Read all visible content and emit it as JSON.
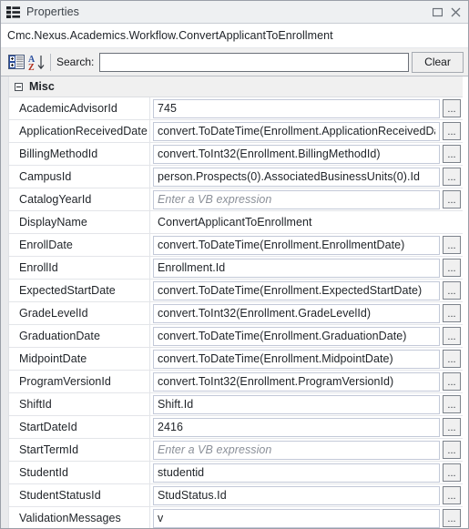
{
  "window": {
    "title": "Properties",
    "icon": "properties-grid-icon",
    "controls": [
      {
        "name": "maximize-button",
        "glyph": "maximize-icon"
      },
      {
        "name": "close-button",
        "glyph": "close-icon"
      }
    ]
  },
  "type_header": {
    "text": "Cmc.Nexus.Academics.Workflow.ConvertApplicantToEnrollment"
  },
  "toolbar": {
    "categorized_button": "categorized-view-icon",
    "alphabetical_button": "sort-alphabetical-icon",
    "search_label": "Search:",
    "search_value": "",
    "search_placeholder": "",
    "clear_label": "Clear"
  },
  "colors": {
    "titlebar_bg": "#eef0f2",
    "toolbar_bg": "#f0f0f0",
    "category_bg": "#f0f0f0",
    "field_border": "#c3c9d8",
    "window_border": "#9a9fa8",
    "placeholder_text": "#8b9099",
    "sort_letter_a": "#2b4f9e",
    "sort_letter_z": "#b0301f"
  },
  "grid": {
    "category": {
      "label": "Misc",
      "expanded": true,
      "toggle_glyph": "−"
    },
    "ellipsis_label": "...",
    "placeholder": "Enter a VB expression",
    "rows": [
      {
        "name": "AcademicAdvisorId",
        "value": "745",
        "placeholder": false,
        "has_ellipsis": true
      },
      {
        "name": "ApplicationReceivedDate",
        "value": "convert.ToDateTime(Enrollment.ApplicationReceivedDate)",
        "placeholder": false,
        "has_ellipsis": true
      },
      {
        "name": "BillingMethodId",
        "value": "convert.ToInt32(Enrollment.BillingMethodId)",
        "placeholder": false,
        "has_ellipsis": true
      },
      {
        "name": "CampusId",
        "value": "person.Prospects(0).AssociatedBusinessUnits(0).Id",
        "placeholder": false,
        "has_ellipsis": true
      },
      {
        "name": "CatalogYearId",
        "value": "Enter a VB expression",
        "placeholder": true,
        "has_ellipsis": true
      },
      {
        "name": "DisplayName",
        "value": "ConvertApplicantToEnrollment",
        "placeholder": false,
        "has_ellipsis": false
      },
      {
        "name": "EnrollDate",
        "value": "convert.ToDateTime(Enrollment.EnrollmentDate)",
        "placeholder": false,
        "has_ellipsis": true
      },
      {
        "name": "EnrollId",
        "value": "Enrollment.Id",
        "placeholder": false,
        "has_ellipsis": true
      },
      {
        "name": "ExpectedStartDate",
        "value": "convert.ToDateTime(Enrollment.ExpectedStartDate)",
        "placeholder": false,
        "has_ellipsis": true
      },
      {
        "name": "GradeLevelId",
        "value": "convert.ToInt32(Enrollment.GradeLevelId)",
        "placeholder": false,
        "has_ellipsis": true
      },
      {
        "name": "GraduationDate",
        "value": "convert.ToDateTime(Enrollment.GraduationDate)",
        "placeholder": false,
        "has_ellipsis": true
      },
      {
        "name": "MidpointDate",
        "value": "convert.ToDateTime(Enrollment.MidpointDate)",
        "placeholder": false,
        "has_ellipsis": true
      },
      {
        "name": "ProgramVersionId",
        "value": "convert.ToInt32(Enrollment.ProgramVersionId)",
        "placeholder": false,
        "has_ellipsis": true
      },
      {
        "name": "ShiftId",
        "value": "Shift.Id",
        "placeholder": false,
        "has_ellipsis": true
      },
      {
        "name": "StartDateId",
        "value": "2416",
        "placeholder": false,
        "has_ellipsis": true
      },
      {
        "name": "StartTermId",
        "value": "Enter a VB expression",
        "placeholder": true,
        "has_ellipsis": true
      },
      {
        "name": "StudentId",
        "value": "studentid",
        "placeholder": false,
        "has_ellipsis": true
      },
      {
        "name": "StudentStatusId",
        "value": "StudStatus.Id",
        "placeholder": false,
        "has_ellipsis": true
      },
      {
        "name": "ValidationMessages",
        "value": "v",
        "placeholder": false,
        "has_ellipsis": true
      }
    ]
  }
}
